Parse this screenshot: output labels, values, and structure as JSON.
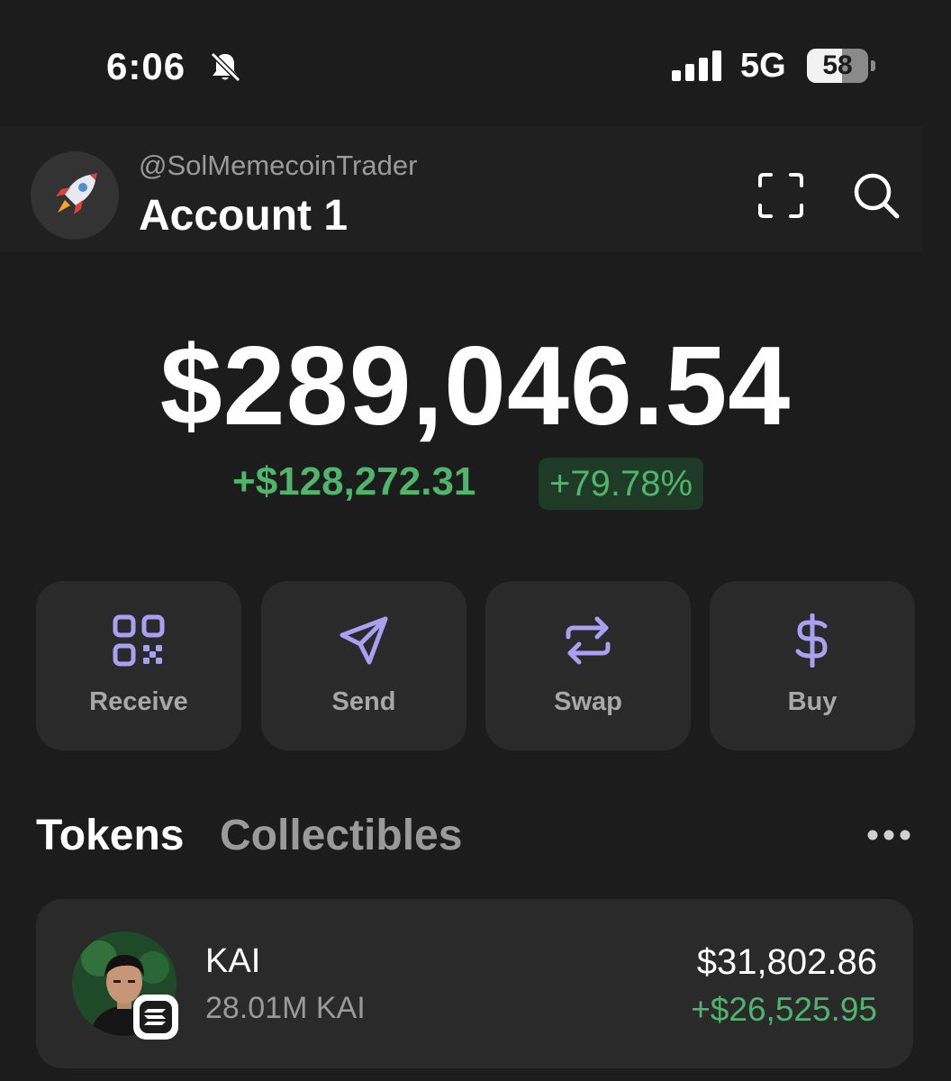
{
  "status_bar": {
    "time": "6:06",
    "network": "5G",
    "battery_percent": 58,
    "battery_label": "58",
    "icons": [
      "bell-slash-icon",
      "cellular-signal-icon",
      "battery-icon"
    ]
  },
  "header": {
    "handle": "@SolMemecoinTrader",
    "account_name": "Account 1",
    "avatar_icon": "rocket-icon",
    "actions": [
      "scan-icon",
      "search-icon"
    ]
  },
  "balance": {
    "total": "$289,046.54",
    "change_amount": "+$128,272.31",
    "change_percent": "+79.78%"
  },
  "actions": [
    {
      "label": "Receive",
      "icon": "qr-code-icon"
    },
    {
      "label": "Send",
      "icon": "send-icon"
    },
    {
      "label": "Swap",
      "icon": "swap-icon"
    },
    {
      "label": "Buy",
      "icon": "dollar-icon"
    }
  ],
  "tabs": {
    "tokens": "Tokens",
    "collectibles": "Collectibles",
    "active": "Tokens",
    "more_icon": "more-dots-icon"
  },
  "tokens": [
    {
      "name": "KAI",
      "amount": "28.01M KAI",
      "value": "$31,802.86",
      "change": "+$26,525.95",
      "chain_icon": "solana-icon"
    }
  ],
  "colors": {
    "background": "#1c1c1c",
    "card": "#2a2a2a",
    "accent": "#ab9ff2",
    "positive": "#4fb56a"
  }
}
